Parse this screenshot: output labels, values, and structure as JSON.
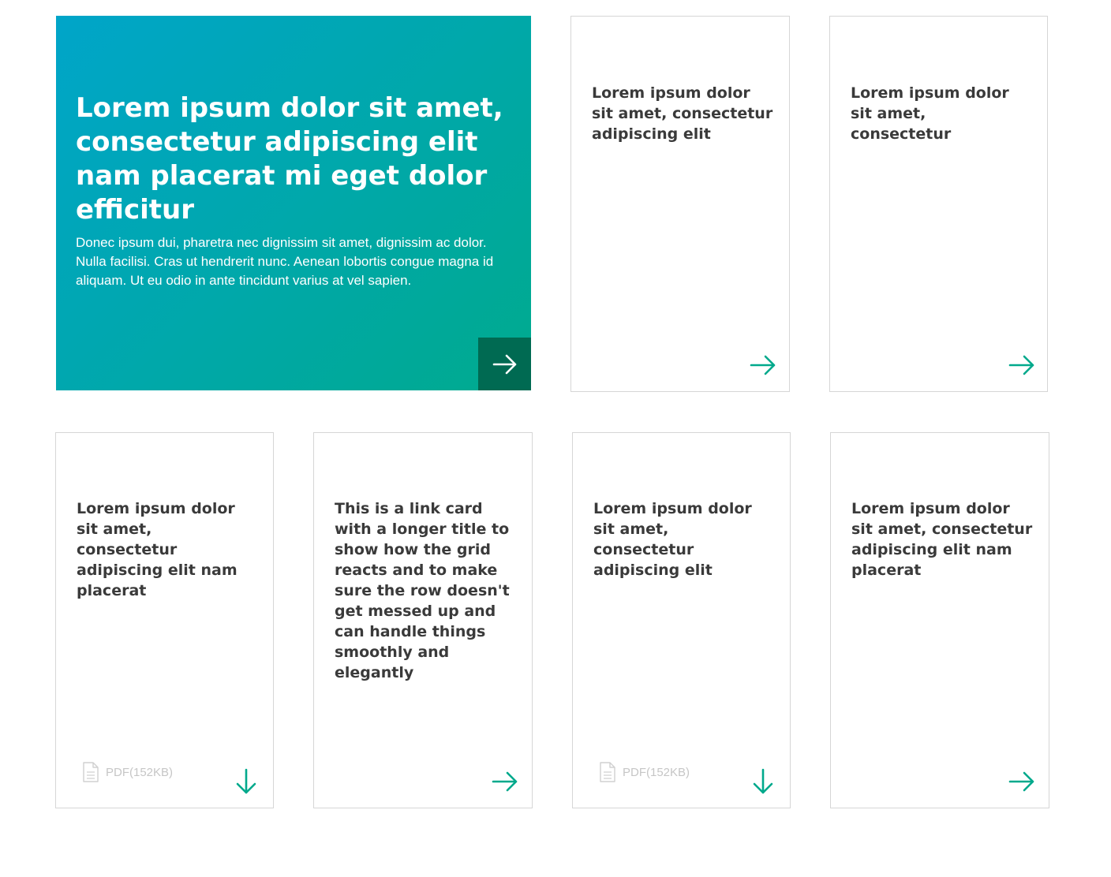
{
  "colors": {
    "accent": "#00a98c",
    "hero_gradient_start": "#00a5c9",
    "hero_gradient_end": "#00aa8e",
    "hero_button": "#006a52",
    "border": "#d6d6d6",
    "muted_text": "#c6c6c6"
  },
  "hero": {
    "title": "Lorem ipsum dolor sit amet, consectetur adipiscing elit nam placerat mi eget dolor efficitur",
    "description": "Donec ipsum dui, pharetra nec dignissim sit amet, dignissim ac dolor. Nulla facilisi. Cras ut hendrerit nunc. Aenean lobortis congue magna id aliquam. Ut eu odio in ante tincidunt varius at vel sapien.",
    "icon": "arrow-right-icon"
  },
  "top_cards": [
    {
      "title": "Lorem ipsum dolor sit amet, consectetur adipiscing elit",
      "icon": "arrow-right-icon"
    },
    {
      "title": "Lorem ipsum dolor sit amet, consectetur",
      "icon": "arrow-right-icon"
    }
  ],
  "bottom_cards": [
    {
      "title": "Lorem ipsum dolor sit amet, consectetur adipiscing elit nam placerat",
      "file_label": "PDF(152KB)",
      "icon": "arrow-down-icon"
    },
    {
      "title": "This is a link card with a longer title to show how the grid reacts and to make sure the row doesn't get messed up and can handle things smoothly and elegantly",
      "icon": "arrow-right-icon"
    },
    {
      "title": "Lorem ipsum dolor sit amet, consectetur adipiscing elit",
      "file_label": "PDF(152KB)",
      "icon": "arrow-down-icon"
    },
    {
      "title": "Lorem ipsum dolor sit amet, consectetur adipiscing elit nam placerat",
      "icon": "arrow-right-icon"
    }
  ]
}
